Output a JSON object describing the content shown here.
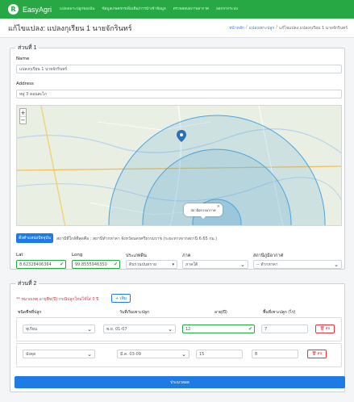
{
  "nav": {
    "logo": "R",
    "brand": "EasyAgri",
    "links": [
      "แปลงเพาะปลูกของฉัน",
      "ข้อมูลเกษตรกรเพิ่มเติม/การนำเข้าข้อมูล",
      "ตรวจสอบสภาพอากาศ",
      "ออกจากระบบ"
    ]
  },
  "header": {
    "title": "แก้ไขแปลง: แปลงกุเรียน 1 นายจักรินทร์",
    "crumbs": [
      "หน้าหลัก",
      "/",
      "แปลงเพาะปลูก",
      "/",
      "แก้ไขแปลง แปลงกุเรียน 1 นายจักรินทร์"
    ]
  },
  "section1": {
    "legend": "ส่วนที่ 1",
    "name_label": "Name",
    "name_value": "แปลงกุเรียน 1 นายจักรินทร์",
    "address_label": "Address",
    "address_value": "หมู่ 3 ดอนสะไก",
    "zoom_in": "+",
    "zoom_out": "−",
    "popup_text": "สถานีตรวจอากาศ",
    "popup_close": "×",
    "locate_button": "ดึงตำแหน่งปัจจุบัน",
    "station_note": "สถานีที่ใกล้ที่สุดคือ : สถานีทำกหาคา จังหวัดนครศรีธรรมราช (ระยะทางจากสถานี 6.65 กม.)",
    "lat_label": "Lat",
    "lat_value": "8.62328406364",
    "long_label": "Long",
    "long_value": "99.8555946350",
    "prov_label": "ประเภทดิน",
    "prov_value": "ดินร่วนปนทราย",
    "region_label": "ภาค",
    "region_value": "ภาคใต้",
    "weather_label": "สถานีภูมิอากาศ",
    "weather_value": "-- ทำกหาคา"
  },
  "section2": {
    "legend": "ส่วนที่ 2",
    "warning": "** หมายเหตุ อายุพืช(ปี) กรณีปลูกใหม่ให้ใส่ 0 ปี",
    "add_button": "+ เพิ่ม",
    "col_crop": "ชนิดพืชที่ปลูก",
    "col_date": "วันที่เริ่มเพาะปลูก",
    "col_age": "อายุ(ปี)",
    "col_area": "พื้นที่เพาะปลูก (ไร่)",
    "rows": [
      {
        "crop": "ทุเรียน",
        "date": "พ.ย. 01-07",
        "age": "12",
        "area": "7",
        "del": "ลบ"
      },
      {
        "crop": "มังคุด",
        "date": "มี.ค. 03-09",
        "age": "15",
        "area": "8",
        "del": "ลบ"
      }
    ]
  },
  "submit_button": "ประมวลผล",
  "colors": {
    "accent": "#28a745",
    "primary": "#1e7be6",
    "danger": "#dc3545"
  }
}
